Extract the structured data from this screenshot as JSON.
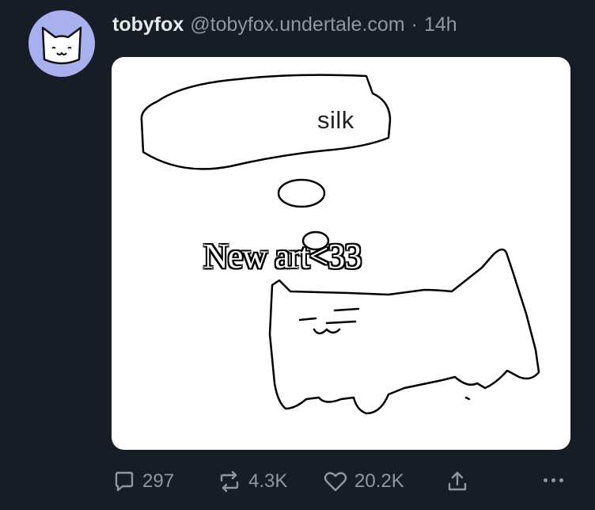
{
  "post": {
    "display_name": "tobyfox",
    "handle": "@tobyfox.undertale.com",
    "separator": "·",
    "time": "14h",
    "avatar_icon": "white-cat-face-icon",
    "avatar_color": "#a9b0ee"
  },
  "media": {
    "drawing_text": "silk",
    "overlay_caption": "New art<33",
    "background": "#ffffff"
  },
  "actions": {
    "replies": "297",
    "reposts": "4.3K",
    "likes": "20.2K",
    "reply_icon": "comment-bubble-icon",
    "repost_icon": "repost-arrows-icon",
    "like_icon": "heart-icon",
    "share_icon": "share-upload-icon",
    "more_icon": "more-ellipsis-icon"
  },
  "colors": {
    "background": "#161d27",
    "text_primary": "#e7e9ea",
    "text_secondary": "#8b98a5"
  }
}
